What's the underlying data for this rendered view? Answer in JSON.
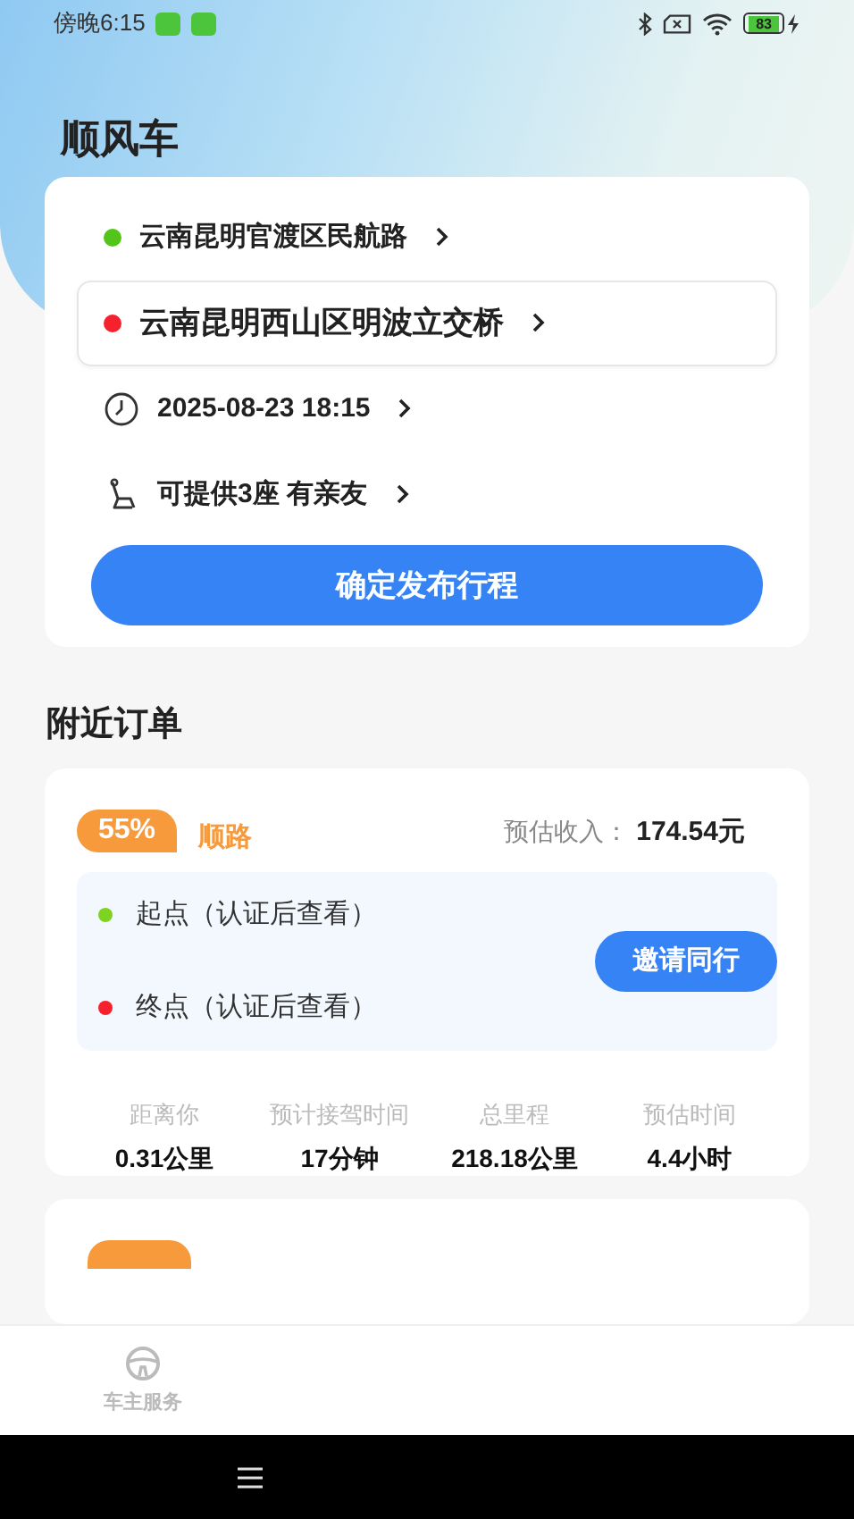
{
  "status_bar": {
    "time": "傍晚6:15",
    "battery": "83"
  },
  "title": "顺风车",
  "trip_form": {
    "rows": [
      {
        "kind": "place",
        "text": "云南昆明官渡区民航路",
        "color": "#52c41a",
        "selected": false
      },
      {
        "kind": "place",
        "text": "云南昆明西山区明波立交桥",
        "color": "#f5222d",
        "selected": true
      },
      {
        "kind": "time",
        "text": "2025-08-23 18:15",
        "selected": false
      },
      {
        "kind": "seats",
        "text": "可提供3座 有亲友",
        "selected": false
      }
    ],
    "submit": "确定发布行程"
  },
  "nearby": {
    "title": "附近订单",
    "orders": [
      {
        "kind": "full",
        "match": "55%",
        "match_label": "顺路",
        "income_label": "预估收入：",
        "income": "174.54元",
        "stops": [
          {
            "text": "起点（认证后查看）",
            "color": "#7ed321"
          },
          {
            "text": "终点（认证后查看）",
            "color": "#f5222d"
          }
        ],
        "action": "邀请同行",
        "stats": [
          {
            "label": "距离你",
            "value": "0.31公里"
          },
          {
            "label": "预计接驾时间",
            "value": "17分钟"
          },
          {
            "label": "总里程",
            "value": "218.18公里"
          },
          {
            "label": "预估时间",
            "value": "4.4小时"
          }
        ]
      },
      {
        "kind": "cut_off"
      }
    ]
  },
  "bottom_nav": {
    "tabs": [
      {
        "label": "车主服务",
        "selected": false
      }
    ]
  }
}
